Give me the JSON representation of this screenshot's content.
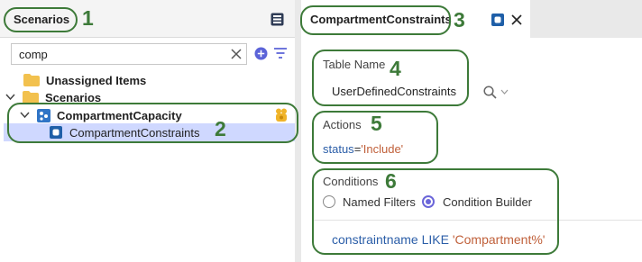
{
  "left_panel": {
    "title": "Scenarios",
    "search": {
      "value": "comp",
      "placeholder": ""
    },
    "tree": [
      {
        "label": "Unassigned Items"
      },
      {
        "label": "Scenarios"
      },
      {
        "label": "CompartmentCapacity"
      },
      {
        "label": "CompartmentConstraints"
      }
    ]
  },
  "editor": {
    "tab_title": "CompartmentConstraints",
    "table_name": {
      "label": "Table Name",
      "value": "UserDefinedConstraints"
    },
    "actions": {
      "label": "Actions",
      "field": "status",
      "operator": "=",
      "value": "'Include'"
    },
    "conditions": {
      "label": "Conditions",
      "radio_named_filters": "Named Filters",
      "radio_condition_builder": "Condition Builder",
      "selected": "Condition Builder",
      "expression": {
        "field": "constraintname",
        "operator": "LIKE",
        "value": "'Compartment%'"
      }
    }
  },
  "annotations": {
    "n1": "1",
    "n2": "2",
    "n3": "3",
    "n4": "4",
    "n5": "5",
    "n6": "6"
  },
  "colors": {
    "annotation": "#3d7a39",
    "selection": "#cfd8ff",
    "folder": "#f2c14e",
    "accent_blue": "#1f5fa8",
    "string_value": "#c0603a",
    "keyword_blue": "#2b5ea8",
    "radio_purple": "#6b66d9"
  },
  "icons": [
    "database-icon",
    "clear-icon",
    "add-circle-icon",
    "filter-icon",
    "folder-icon",
    "chevron-down-icon",
    "scenario-icon",
    "table-icon",
    "badge-icon",
    "close-icon",
    "search-icon"
  ]
}
